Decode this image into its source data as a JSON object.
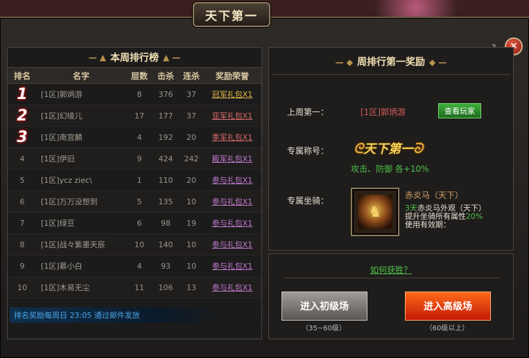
{
  "window": {
    "title": "天下第一",
    "help": "?",
    "close": "✕"
  },
  "ranking": {
    "title": "本周排行榜",
    "headers": {
      "rank": "排名",
      "name": "名字",
      "floor": "层数",
      "kills": "击杀",
      "streak": "连杀",
      "award": "奖励荣誉"
    },
    "rows": [
      {
        "rank": "1",
        "name": "[1区]郭炳游",
        "floor": "8",
        "kills": "376",
        "streak": "37",
        "award": "冠军礼包X1"
      },
      {
        "rank": "2",
        "name": "[1区]幻绫儿",
        "floor": "17",
        "kills": "177",
        "streak": "37",
        "award": "亚军礼包X1"
      },
      {
        "rank": "3",
        "name": "[1区]南宫麟",
        "floor": "4",
        "kills": "192",
        "streak": "20",
        "award": "季军礼包X1"
      },
      {
        "rank": "4",
        "name": "[1区]伊旧",
        "floor": "9",
        "kills": "424",
        "streak": "242",
        "award": "殿军礼包X1"
      },
      {
        "rank": "5",
        "name": "[1区]ycz ziec\\",
        "floor": "1",
        "kills": "110",
        "streak": "20",
        "award": "参与礼包X1"
      },
      {
        "rank": "6",
        "name": "[1区]万万没想到",
        "floor": "5",
        "kills": "135",
        "streak": "10",
        "award": "参与礼包X1"
      },
      {
        "rank": "7",
        "name": "[1区]绿豆",
        "floor": "6",
        "kills": "98",
        "streak": "19",
        "award": "参与礼包X1"
      },
      {
        "rank": "8",
        "name": "[1区]战々紫墨天辰",
        "floor": "10",
        "kills": "140",
        "streak": "10",
        "award": "参与礼包X1"
      },
      {
        "rank": "9",
        "name": "[1区]慕小白",
        "floor": "4",
        "kills": "93",
        "streak": "10",
        "award": "参与礼包X1"
      },
      {
        "rank": "10",
        "name": "[1区]木易无尘",
        "floor": "11",
        "kills": "106",
        "streak": "13",
        "award": "参与礼包X1"
      }
    ],
    "footer": "排名奖励每周日 23:05 通过邮件发放"
  },
  "reward": {
    "title": "周排行第一奖励",
    "last_week_label": "上周第一：",
    "last_week_player": "[1区]郭炳游",
    "view_button": "查看玩家",
    "title_label": "专属称号：",
    "title_badge": "天下第一",
    "title_bonus": "攻击、防御 各+10%",
    "mount_label": "专属坐骑：",
    "mount_name": "赤炎马（天下）",
    "mount_line1_green": "3天",
    "mount_line1": "赤炎马外观（天下）",
    "mount_line2": "提升坐骑所有属性",
    "mount_line2_green": "20%",
    "mount_line3": "使用有效期："
  },
  "actions": {
    "how_to_win": "如何获胜？",
    "enter_low": "进入初级场",
    "enter_low_range": "（35~60级）",
    "enter_high": "进入高级场",
    "enter_high_range": "（60级以上）"
  }
}
